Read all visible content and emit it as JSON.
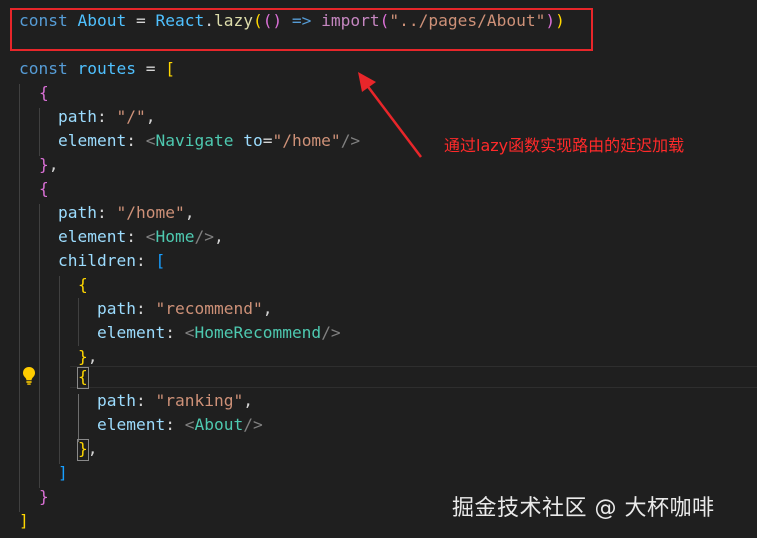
{
  "code": {
    "line1": {
      "kw": "const",
      "name": "About",
      "eq": " = ",
      "obj": "React",
      "dot": ".",
      "fn": "lazy",
      "open": "(",
      "params": "()",
      "arrow": " => ",
      "import": "import",
      "paren_open": "(",
      "path": "\"../pages/About\"",
      "paren_close": ")",
      "close": ")"
    },
    "line3": {
      "kw": "const",
      "name": "routes",
      "eq": " = ",
      "bracket": "["
    },
    "line4": {
      "brace": "{"
    },
    "line5": {
      "key": "path",
      "colon": ": ",
      "value": "\"/\"",
      "comma": ","
    },
    "line6": {
      "key": "element",
      "colon": ": ",
      "lt": "<",
      "tag": "Navigate",
      "attr": "to",
      "eq": "=",
      "value": "\"/home\"",
      "gt": "/>"
    },
    "line7": {
      "brace": "}",
      "comma": ","
    },
    "line8": {
      "brace": "{"
    },
    "line9": {
      "key": "path",
      "colon": ": ",
      "value": "\"/home\"",
      "comma": ","
    },
    "line10": {
      "key": "element",
      "colon": ": ",
      "lt": "<",
      "tag": "Home",
      "gt": "/>",
      "comma": ","
    },
    "line11": {
      "key": "children",
      "colon": ": ",
      "bracket": "["
    },
    "line12": {
      "brace": "{"
    },
    "line13": {
      "key": "path",
      "colon": ": ",
      "value": "\"recommend\"",
      "comma": ","
    },
    "line14": {
      "key": "element",
      "colon": ": ",
      "lt": "<",
      "tag": "HomeRecommend",
      "gt": "/>"
    },
    "line15": {
      "brace": "}",
      "comma": ","
    },
    "line16": {
      "brace": "{"
    },
    "line17": {
      "key": "path",
      "colon": ": ",
      "value": "\"ranking\"",
      "comma": ","
    },
    "line18": {
      "key": "element",
      "colon": ": ",
      "lt": "<",
      "tag": "About",
      "gt": "/>"
    },
    "line19": {
      "brace": "}",
      "comma": ","
    },
    "line20": {
      "bracket": "]"
    },
    "line21": {
      "brace": "}"
    },
    "line22": {
      "bracket": "]"
    }
  },
  "annotation": {
    "text": "通过lazy函数实现路由的延迟加载",
    "color": "#ff2a2a"
  },
  "watermark": {
    "text": "掘金技术社区 @ 大杯咖啡"
  },
  "icons": {
    "lightbulb": "lightbulb-icon",
    "arrow": "red-arrow"
  },
  "colors": {
    "background": "#1f1f1f",
    "highlight_box": "#e8262a",
    "keyword": "#569cd6",
    "string": "#ce9178",
    "tag": "#4ec9b0"
  }
}
